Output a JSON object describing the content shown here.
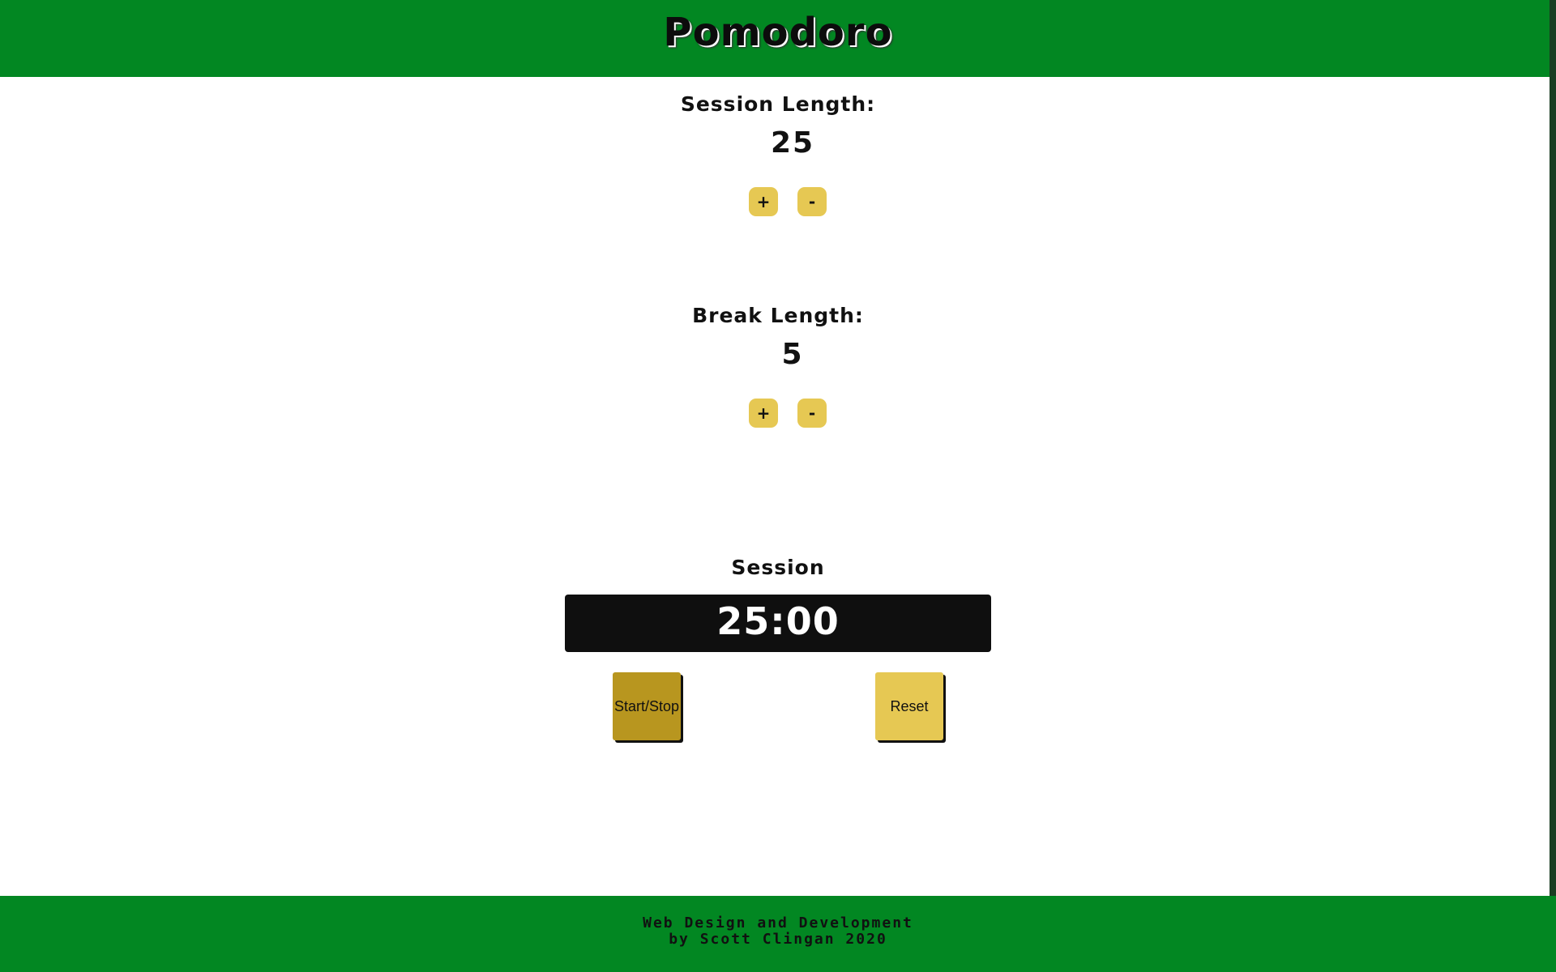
{
  "app": {
    "title": "Pomodoro"
  },
  "session_length": {
    "label": "Session Length:",
    "value": "25",
    "increment_label": "+",
    "decrement_label": "-"
  },
  "break_length": {
    "label": "Break Length:",
    "value": "5",
    "increment_label": "+",
    "decrement_label": "-"
  },
  "timer": {
    "mode_label": "Session",
    "display": "25:00",
    "start_stop_label": "Start/Stop",
    "reset_label": "Reset"
  },
  "footer": {
    "line1": "Web Design and Development",
    "line2": "by Scott Clingan 2020"
  },
  "colors": {
    "header_green": "#028722",
    "button_yellow": "#e6c853",
    "start_button_gold": "#b8961f",
    "timer_background": "#0f0f0f"
  }
}
